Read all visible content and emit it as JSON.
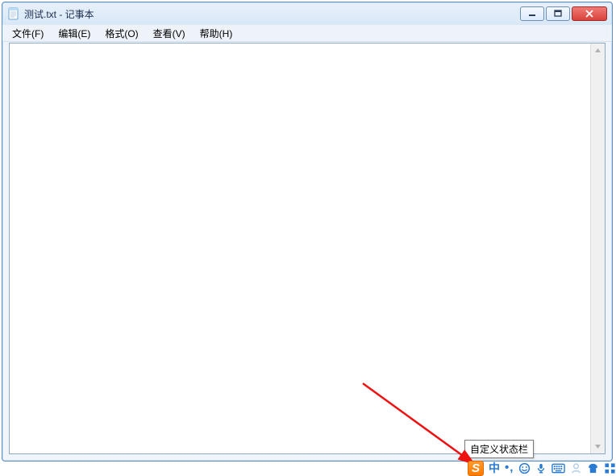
{
  "window": {
    "title": "测试.txt - 记事本"
  },
  "menubar": {
    "items": [
      {
        "label": "文件(F)"
      },
      {
        "label": "编辑(E)"
      },
      {
        "label": "格式(O)"
      },
      {
        "label": "查看(V)"
      },
      {
        "label": "帮助(H)"
      }
    ]
  },
  "editor": {
    "content": ""
  },
  "tooltip": {
    "text": "自定义状态栏"
  },
  "ime": {
    "logo_letter": "S",
    "lang_label": "中",
    "punct_label": "•,"
  }
}
